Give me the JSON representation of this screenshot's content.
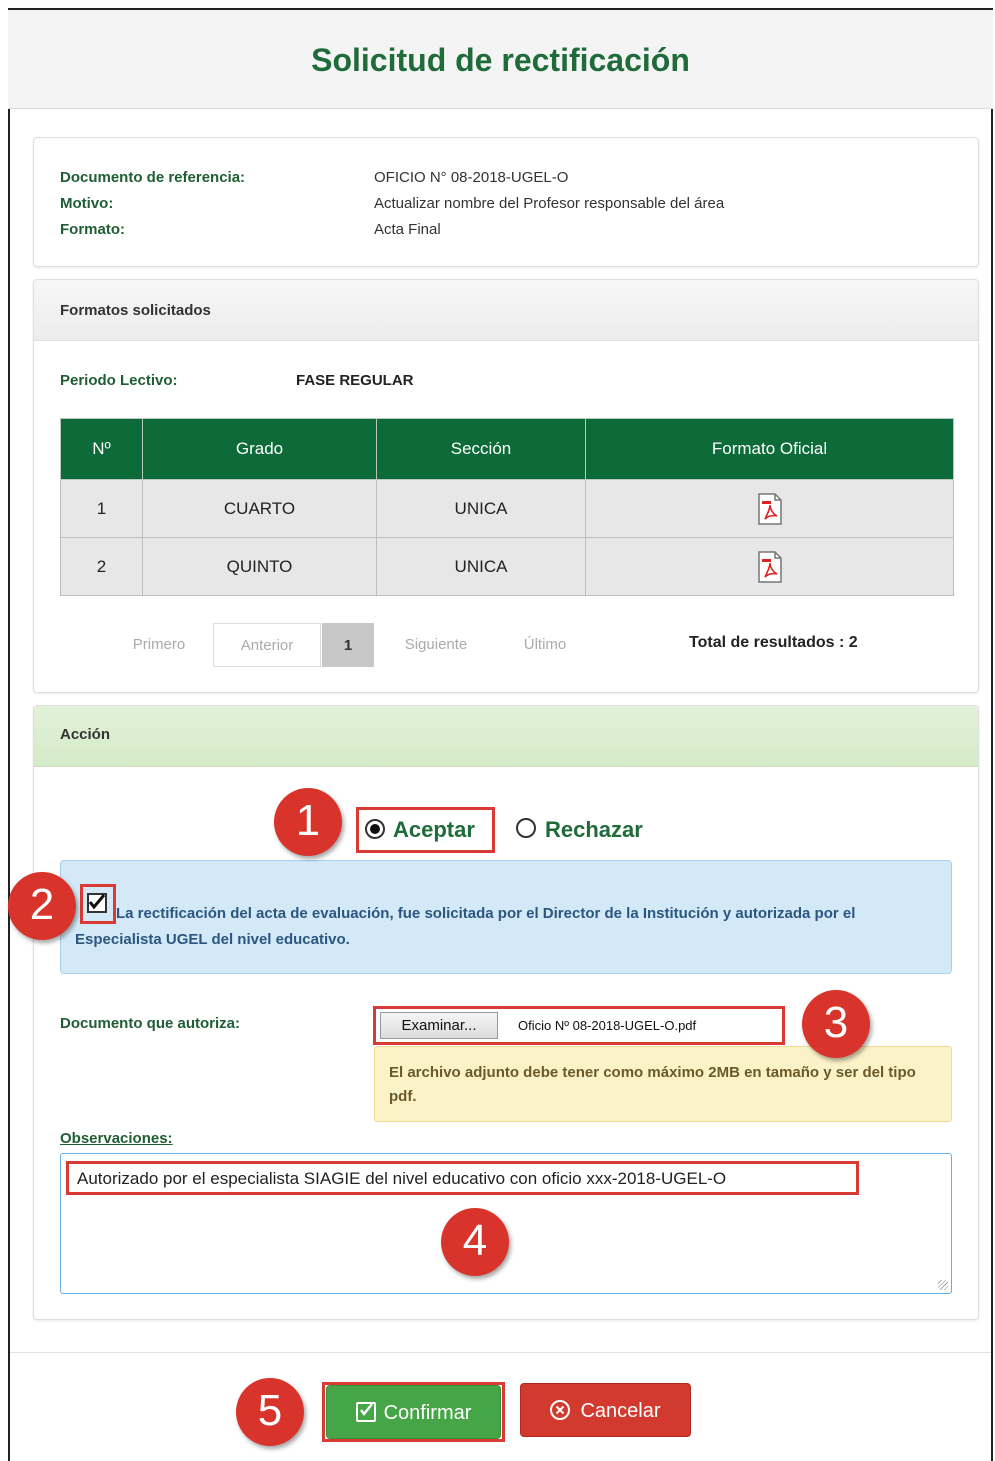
{
  "page": {
    "title": "Solicitud de rectificación"
  },
  "reference": {
    "fields": [
      {
        "label": "Documento de referencia:",
        "value": "OFICIO N° 08-2018-UGEL-O"
      },
      {
        "label": "Motivo:",
        "value": "Actualizar nombre del Profesor responsable del área"
      },
      {
        "label": "Formato:",
        "value": "Acta Final"
      }
    ]
  },
  "formats": {
    "heading": "Formatos solicitados",
    "period_label": "Periodo Lectivo:",
    "period_value": "FASE REGULAR",
    "columns": [
      "Nº",
      "Grado",
      "Sección",
      "Formato Oficial"
    ],
    "rows": [
      {
        "n": "1",
        "grado": "CUARTO",
        "seccion": "UNICA",
        "formato_icon": "pdf-icon"
      },
      {
        "n": "2",
        "grado": "QUINTO",
        "seccion": "UNICA",
        "formato_icon": "pdf-icon"
      }
    ],
    "pagination": {
      "first": "Primero",
      "prev": "Anterior",
      "current": "1",
      "next": "Siguiente",
      "last": "Último"
    },
    "total": "Total de resultados : 2"
  },
  "action": {
    "heading": "Acción",
    "accept_label": "Aceptar",
    "reject_label": "Rechazar",
    "selected": "Aceptar",
    "checkbox_checked": true,
    "checkbox_text": "La rectificación del acta de evaluación, fue solicitada por el Director de la Institución y autorizada por el Especialista UGEL del nivel educativo.",
    "doc_label": "Documento que autoriza:",
    "browse_label": "Examinar...",
    "file_name": "Oficio Nº 08-2018-UGEL-O.pdf",
    "file_note": "El archivo adjunto debe tener como máximo 2MB en tamaño y ser del tipo pdf.",
    "obs_label": "Observaciones:",
    "obs_value": "Autorizado por el especialista SIAGIE del nivel educativo con oficio xxx-2018-UGEL-O"
  },
  "buttons": {
    "confirm": "Confirmar",
    "cancel": "Cancelar"
  },
  "callouts": [
    "1",
    "2",
    "3",
    "4",
    "5"
  ],
  "colors": {
    "title": "#1f6b3a",
    "table_header": "#0c6b38",
    "callout": "#d9342b",
    "confirm": "#46a546",
    "cancel": "#d2392f"
  }
}
